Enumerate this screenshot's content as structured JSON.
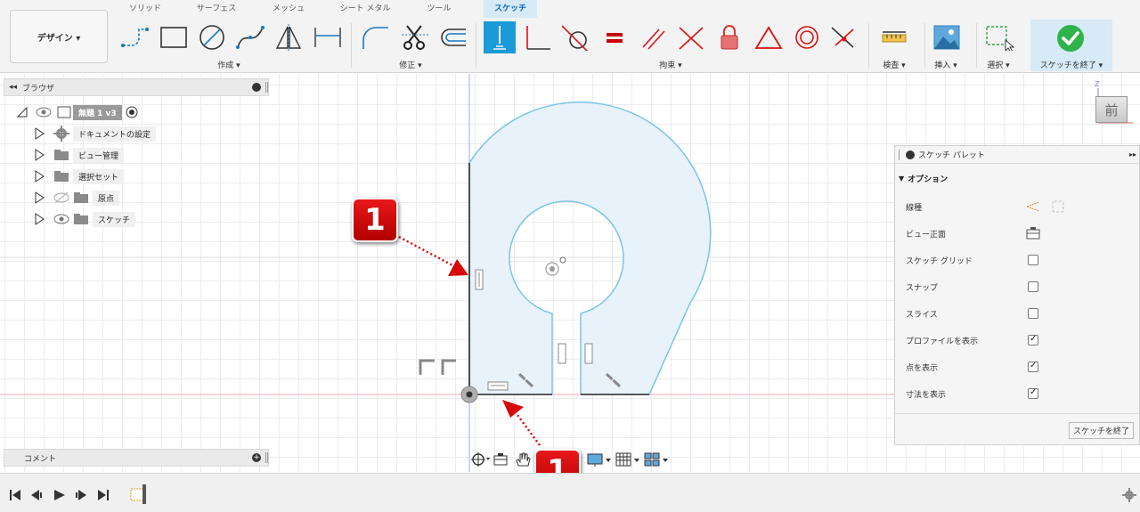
{
  "tabs": [
    {
      "label": "ソリッド"
    },
    {
      "label": "サーフェス"
    },
    {
      "label": "メッシュ"
    },
    {
      "label": "シート メタル"
    },
    {
      "label": "ツール"
    },
    {
      "label": "スケッチ"
    }
  ],
  "workspace": {
    "label": "デザイン ▾"
  },
  "groups": {
    "create": "作成 ▾",
    "modify": "修正 ▾",
    "constraints": "拘束 ▾",
    "inspect": "検査 ▾",
    "insert": "挿入 ▾",
    "select": "選択 ▾",
    "finish": "スケッチを終了 ▾"
  },
  "browser": {
    "title": "ブラウザ",
    "root": "無題 1  v3",
    "items": [
      {
        "label": "ドキュメントの設定"
      },
      {
        "label": "ビュー管理"
      },
      {
        "label": "選択セット"
      },
      {
        "label": "原点"
      },
      {
        "label": "スケッチ"
      }
    ]
  },
  "palette": {
    "title": "スケッチ パレット",
    "section": "オプション",
    "rows": [
      {
        "label": "線種"
      },
      {
        "label": "ビュー正面"
      },
      {
        "label": "スケッチ グリッド",
        "checked": false
      },
      {
        "label": "スナップ",
        "checked": false
      },
      {
        "label": "スライス",
        "checked": false
      },
      {
        "label": "プロファイルを表示",
        "checked": true
      },
      {
        "label": "点を表示",
        "checked": true
      },
      {
        "label": "寸法を表示",
        "checked": true
      }
    ],
    "finish_button": "スケッチを終了"
  },
  "comment": {
    "label": "コメント"
  },
  "viewcube": {
    "face": "前",
    "axis": "Z"
  },
  "callouts": [
    {
      "number": "1"
    },
    {
      "number": "1"
    }
  ],
  "colors": {
    "accent": "#1a9ad6",
    "callout_red": "#d60a0a",
    "profile_fill": "#e8f2fb",
    "sketch_line": "#7cc4e6",
    "finish_green": "#2fb34a"
  }
}
